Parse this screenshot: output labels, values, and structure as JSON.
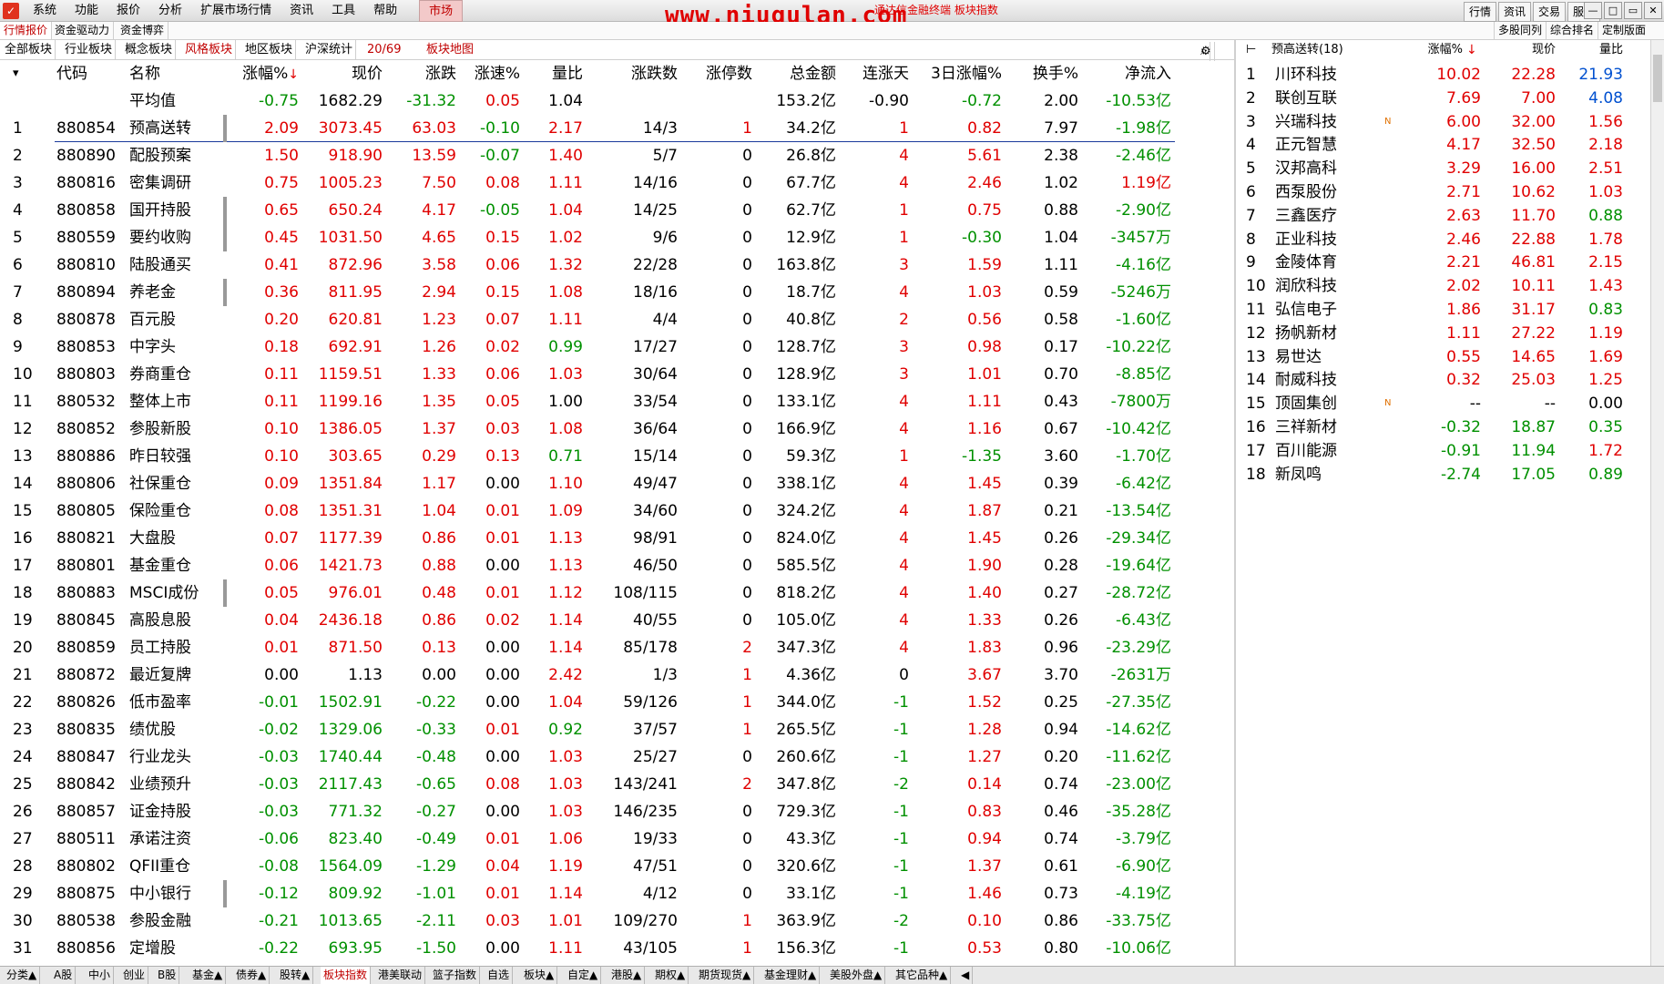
{
  "menu": [
    "系统",
    "功能",
    "报价",
    "分析",
    "扩展市场行情",
    "资讯",
    "工具",
    "帮助",
    "市场"
  ],
  "watermark": "www.niugulan.com",
  "watermark_sub": "通达信金融终端 板块指数",
  "title_right_buttons": [
    "行情",
    "资讯",
    "交易",
    "服务"
  ],
  "window_controls": [
    "—",
    "□",
    "▭",
    "✕"
  ],
  "tabs_top": [
    "行情报价",
    "资金驱动力",
    "资金博弈"
  ],
  "tabs_top_right": [
    "多股同列",
    "综合排名",
    "定制版面"
  ],
  "tabs_second": [
    "全部板块",
    "行业板块",
    "概念板块",
    "风格板块",
    "地区板块",
    "沪深统计"
  ],
  "page_count": "20/69",
  "block_map": "板块地图",
  "table": {
    "headers": {
      "code": "代码",
      "name": "名称",
      "pct": "涨幅%",
      "price": "现价",
      "chg": "涨跌",
      "spd": "涨速%",
      "vol": "量比",
      "ud": "涨跌数",
      "lim": "涨停数",
      "amt": "总金额",
      "days": "连涨天",
      "d3": "3日涨幅%",
      "turn": "换手%",
      "net": "净流入"
    },
    "avg": {
      "name": "平均值",
      "pct": "-0.75",
      "price": "1682.29",
      "chg": "-31.32",
      "spd": "0.05",
      "vol": "1.04",
      "ud": "",
      "lim": "",
      "amt": "153.2亿",
      "days": "-0.90",
      "d3": "-0.72",
      "turn": "2.00",
      "net": "-10.53亿"
    },
    "rows": [
      {
        "idx": "1",
        "code": "880854",
        "name": "预高送转",
        "dot": true,
        "pct": "2.09",
        "price": "3073.45",
        "chg": "63.03",
        "spd": "-0.10",
        "vol": "2.17",
        "ud": "14/3",
        "lim": "1",
        "amt": "34.2亿",
        "days": "1",
        "d3": "0.82",
        "turn": "7.97",
        "net": "-1.98亿"
      },
      {
        "idx": "2",
        "code": "880890",
        "name": "配股预案",
        "dot": false,
        "pct": "1.50",
        "price": "918.90",
        "chg": "13.59",
        "spd": "-0.07",
        "vol": "1.40",
        "ud": "5/7",
        "lim": "0",
        "amt": "26.8亿",
        "days": "4",
        "d3": "5.61",
        "turn": "2.38",
        "net": "-2.46亿"
      },
      {
        "idx": "3",
        "code": "880816",
        "name": "密集调研",
        "dot": false,
        "pct": "0.75",
        "price": "1005.23",
        "chg": "7.50",
        "spd": "0.08",
        "vol": "1.11",
        "ud": "14/16",
        "lim": "0",
        "amt": "67.7亿",
        "days": "4",
        "d3": "2.46",
        "turn": "1.02",
        "net": "1.19亿"
      },
      {
        "idx": "4",
        "code": "880858",
        "name": "国开持股",
        "dot": true,
        "pct": "0.65",
        "price": "650.24",
        "chg": "4.17",
        "spd": "-0.05",
        "vol": "1.04",
        "ud": "14/25",
        "lim": "0",
        "amt": "62.7亿",
        "days": "1",
        "d3": "0.75",
        "turn": "0.88",
        "net": "-2.90亿"
      },
      {
        "idx": "5",
        "code": "880559",
        "name": "要约收购",
        "dot": true,
        "pct": "0.45",
        "price": "1031.50",
        "chg": "4.65",
        "spd": "0.15",
        "vol": "1.02",
        "ud": "9/6",
        "lim": "0",
        "amt": "12.9亿",
        "days": "1",
        "d3": "-0.30",
        "turn": "1.04",
        "net": "-3457万"
      },
      {
        "idx": "6",
        "code": "880810",
        "name": "陆股通买",
        "dot": false,
        "pct": "0.41",
        "price": "872.96",
        "chg": "3.58",
        "spd": "0.06",
        "vol": "1.32",
        "ud": "22/28",
        "lim": "0",
        "amt": "163.8亿",
        "days": "3",
        "d3": "1.59",
        "turn": "1.11",
        "net": "-4.16亿"
      },
      {
        "idx": "7",
        "code": "880894",
        "name": "养老金",
        "dot": true,
        "pct": "0.36",
        "price": "811.95",
        "chg": "2.94",
        "spd": "0.15",
        "vol": "1.08",
        "ud": "18/16",
        "lim": "0",
        "amt": "18.7亿",
        "days": "4",
        "d3": "1.03",
        "turn": "0.59",
        "net": "-5246万"
      },
      {
        "idx": "8",
        "code": "880878",
        "name": "百元股",
        "dot": false,
        "pct": "0.20",
        "price": "620.81",
        "chg": "1.23",
        "spd": "0.07",
        "vol": "1.11",
        "ud": "4/4",
        "lim": "0",
        "amt": "40.8亿",
        "days": "2",
        "d3": "0.56",
        "turn": "0.58",
        "net": "-1.60亿"
      },
      {
        "idx": "9",
        "code": "880853",
        "name": "中字头",
        "dot": false,
        "pct": "0.18",
        "price": "692.91",
        "chg": "1.26",
        "spd": "0.02",
        "vol": "0.99",
        "ud": "17/27",
        "lim": "0",
        "amt": "128.7亿",
        "days": "3",
        "d3": "0.98",
        "turn": "0.17",
        "net": "-10.22亿"
      },
      {
        "idx": "10",
        "code": "880803",
        "name": "券商重仓",
        "dot": false,
        "pct": "0.11",
        "price": "1159.51",
        "chg": "1.33",
        "spd": "0.06",
        "vol": "1.03",
        "ud": "30/64",
        "lim": "0",
        "amt": "128.9亿",
        "days": "3",
        "d3": "1.01",
        "turn": "0.70",
        "net": "-8.85亿"
      },
      {
        "idx": "11",
        "code": "880532",
        "name": "整体上市",
        "dot": false,
        "pct": "0.11",
        "price": "1199.16",
        "chg": "1.35",
        "spd": "0.05",
        "vol": "1.00",
        "ud": "33/54",
        "lim": "0",
        "amt": "133.1亿",
        "days": "4",
        "d3": "1.11",
        "turn": "0.43",
        "net": "-7800万"
      },
      {
        "idx": "12",
        "code": "880852",
        "name": "参股新股",
        "dot": false,
        "pct": "0.10",
        "price": "1386.05",
        "chg": "1.37",
        "spd": "0.03",
        "vol": "1.08",
        "ud": "36/64",
        "lim": "0",
        "amt": "166.9亿",
        "days": "4",
        "d3": "1.16",
        "turn": "0.67",
        "net": "-10.42亿"
      },
      {
        "idx": "13",
        "code": "880886",
        "name": "昨日较强",
        "dot": false,
        "pct": "0.10",
        "price": "303.65",
        "chg": "0.29",
        "spd": "0.13",
        "vol": "0.71",
        "ud": "15/14",
        "lim": "0",
        "amt": "59.3亿",
        "days": "1",
        "d3": "-1.35",
        "turn": "3.60",
        "net": "-1.70亿"
      },
      {
        "idx": "14",
        "code": "880806",
        "name": "社保重仓",
        "dot": false,
        "pct": "0.09",
        "price": "1351.84",
        "chg": "1.17",
        "spd": "0.00",
        "vol": "1.10",
        "ud": "49/47",
        "lim": "0",
        "amt": "338.1亿",
        "days": "4",
        "d3": "1.45",
        "turn": "0.39",
        "net": "-6.42亿"
      },
      {
        "idx": "15",
        "code": "880805",
        "name": "保险重仓",
        "dot": false,
        "pct": "0.08",
        "price": "1351.31",
        "chg": "1.04",
        "spd": "0.01",
        "vol": "1.09",
        "ud": "34/60",
        "lim": "0",
        "amt": "324.2亿",
        "days": "4",
        "d3": "1.87",
        "turn": "0.21",
        "net": "-13.54亿"
      },
      {
        "idx": "16",
        "code": "880821",
        "name": "大盘股",
        "dot": false,
        "pct": "0.07",
        "price": "1177.39",
        "chg": "0.86",
        "spd": "0.01",
        "vol": "1.13",
        "ud": "98/91",
        "lim": "0",
        "amt": "824.0亿",
        "days": "4",
        "d3": "1.45",
        "turn": "0.26",
        "net": "-29.34亿"
      },
      {
        "idx": "17",
        "code": "880801",
        "name": "基金重仓",
        "dot": false,
        "pct": "0.06",
        "price": "1421.73",
        "chg": "0.88",
        "spd": "0.00",
        "vol": "1.13",
        "ud": "46/50",
        "lim": "0",
        "amt": "585.5亿",
        "days": "4",
        "d3": "1.90",
        "turn": "0.28",
        "net": "-19.64亿"
      },
      {
        "idx": "18",
        "code": "880883",
        "name": "MSCI成份",
        "dot": true,
        "pct": "0.05",
        "price": "976.01",
        "chg": "0.48",
        "spd": "0.01",
        "vol": "1.12",
        "ud": "108/115",
        "lim": "0",
        "amt": "818.2亿",
        "days": "4",
        "d3": "1.40",
        "turn": "0.27",
        "net": "-28.72亿"
      },
      {
        "idx": "19",
        "code": "880845",
        "name": "高股息股",
        "dot": false,
        "pct": "0.04",
        "price": "2436.18",
        "chg": "0.86",
        "spd": "0.02",
        "vol": "1.14",
        "ud": "40/55",
        "lim": "0",
        "amt": "105.0亿",
        "days": "4",
        "d3": "1.33",
        "turn": "0.26",
        "net": "-6.43亿"
      },
      {
        "idx": "20",
        "code": "880859",
        "name": "员工持股",
        "dot": false,
        "pct": "0.01",
        "price": "871.50",
        "chg": "0.13",
        "spd": "0.00",
        "vol": "1.14",
        "ud": "85/178",
        "lim": "2",
        "amt": "347.3亿",
        "days": "4",
        "d3": "1.83",
        "turn": "0.96",
        "net": "-23.29亿"
      },
      {
        "idx": "21",
        "code": "880872",
        "name": "最近复牌",
        "dot": false,
        "pct": "0.00",
        "price": "1.13",
        "chg": "0.00",
        "spd": "0.00",
        "vol": "2.42",
        "ud": "1/3",
        "lim": "1",
        "amt": "4.36亿",
        "days": "0",
        "d3": "3.67",
        "turn": "3.70",
        "net": "-2631万"
      },
      {
        "idx": "22",
        "code": "880826",
        "name": "低市盈率",
        "dot": false,
        "pct": "-0.01",
        "price": "1502.91",
        "chg": "-0.22",
        "spd": "0.00",
        "vol": "1.04",
        "ud": "59/126",
        "lim": "1",
        "amt": "344.0亿",
        "days": "-1",
        "d3": "1.52",
        "turn": "0.25",
        "net": "-27.35亿"
      },
      {
        "idx": "23",
        "code": "880835",
        "name": "绩优股",
        "dot": false,
        "pct": "-0.02",
        "price": "1329.06",
        "chg": "-0.33",
        "spd": "0.01",
        "vol": "0.92",
        "ud": "37/57",
        "lim": "1",
        "amt": "265.5亿",
        "days": "-1",
        "d3": "1.28",
        "turn": "0.94",
        "net": "-14.62亿"
      },
      {
        "idx": "24",
        "code": "880847",
        "name": "行业龙头",
        "dot": false,
        "pct": "-0.03",
        "price": "1740.44",
        "chg": "-0.48",
        "spd": "0.00",
        "vol": "1.03",
        "ud": "25/27",
        "lim": "0",
        "amt": "260.6亿",
        "days": "-1",
        "d3": "1.27",
        "turn": "0.20",
        "net": "-11.62亿"
      },
      {
        "idx": "25",
        "code": "880842",
        "name": "业绩预升",
        "dot": false,
        "pct": "-0.03",
        "price": "2117.43",
        "chg": "-0.65",
        "spd": "0.08",
        "vol": "1.03",
        "ud": "143/241",
        "lim": "2",
        "amt": "347.8亿",
        "days": "-2",
        "d3": "0.14",
        "turn": "0.74",
        "net": "-23.00亿"
      },
      {
        "idx": "26",
        "code": "880857",
        "name": "证金持股",
        "dot": false,
        "pct": "-0.03",
        "price": "771.32",
        "chg": "-0.27",
        "spd": "0.00",
        "vol": "1.03",
        "ud": "146/235",
        "lim": "0",
        "amt": "729.3亿",
        "days": "-1",
        "d3": "0.83",
        "turn": "0.46",
        "net": "-35.28亿"
      },
      {
        "idx": "27",
        "code": "880511",
        "name": "承诺注资",
        "dot": false,
        "pct": "-0.06",
        "price": "823.40",
        "chg": "-0.49",
        "spd": "0.01",
        "vol": "1.06",
        "ud": "19/33",
        "lim": "0",
        "amt": "43.3亿",
        "days": "-1",
        "d3": "0.94",
        "turn": "0.74",
        "net": "-3.79亿"
      },
      {
        "idx": "28",
        "code": "880802",
        "name": "QFII重仓",
        "dot": false,
        "pct": "-0.08",
        "price": "1564.09",
        "chg": "-1.29",
        "spd": "0.04",
        "vol": "1.19",
        "ud": "47/51",
        "lim": "0",
        "amt": "320.6亿",
        "days": "-1",
        "d3": "1.37",
        "turn": "0.61",
        "net": "-6.90亿"
      },
      {
        "idx": "29",
        "code": "880875",
        "name": "中小银行",
        "dot": true,
        "pct": "-0.12",
        "price": "809.92",
        "chg": "-1.01",
        "spd": "0.01",
        "vol": "1.14",
        "ud": "4/12",
        "lim": "0",
        "amt": "33.1亿",
        "days": "-1",
        "d3": "1.46",
        "turn": "0.73",
        "net": "-4.19亿"
      },
      {
        "idx": "30",
        "code": "880538",
        "name": "参股金融",
        "dot": false,
        "pct": "-0.21",
        "price": "1013.65",
        "chg": "-2.11",
        "spd": "0.03",
        "vol": "1.01",
        "ud": "109/270",
        "lim": "1",
        "amt": "363.9亿",
        "days": "-2",
        "d3": "0.10",
        "turn": "0.86",
        "net": "-33.75亿"
      },
      {
        "idx": "31",
        "code": "880856",
        "name": "定增股",
        "dot": false,
        "pct": "-0.22",
        "price": "693.95",
        "chg": "-1.50",
        "spd": "0.00",
        "vol": "1.11",
        "ud": "43/105",
        "lim": "1",
        "amt": "156.3亿",
        "days": "-1",
        "d3": "0.53",
        "turn": "0.80",
        "net": "-10.06亿"
      }
    ]
  },
  "right_panel": {
    "title": "预高送转(18)",
    "headers": {
      "pct": "涨幅%",
      "price": "现价",
      "turn": "量比"
    },
    "rows": [
      {
        "idx": "1",
        "name": "川环科技",
        "flag": "",
        "pct": "10.02",
        "price": "22.28",
        "turn": "21.93",
        "turn_color": "b"
      },
      {
        "idx": "2",
        "name": "联创互联",
        "flag": "",
        "pct": "7.69",
        "price": "7.00",
        "turn": "4.08",
        "turn_color": "b"
      },
      {
        "idx": "3",
        "name": "兴瑞科技",
        "flag": "N",
        "pct": "6.00",
        "price": "32.00",
        "turn": "1.56",
        "turn_color": "r"
      },
      {
        "idx": "4",
        "name": "正元智慧",
        "flag": "",
        "pct": "4.17",
        "price": "32.50",
        "turn": "2.18",
        "turn_color": "r"
      },
      {
        "idx": "5",
        "name": "汉邦高科",
        "flag": "",
        "pct": "3.29",
        "price": "16.00",
        "turn": "2.51",
        "turn_color": "r"
      },
      {
        "idx": "6",
        "name": "西泵股份",
        "flag": "",
        "pct": "2.71",
        "price": "10.62",
        "turn": "1.03",
        "turn_color": "r"
      },
      {
        "idx": "7",
        "name": "三鑫医疗",
        "flag": "",
        "pct": "2.63",
        "price": "11.70",
        "turn": "0.88",
        "turn_color": "g"
      },
      {
        "idx": "8",
        "name": "正业科技",
        "flag": "",
        "pct": "2.46",
        "price": "22.88",
        "turn": "1.78",
        "turn_color": "r"
      },
      {
        "idx": "9",
        "name": "金陵体育",
        "flag": "",
        "pct": "2.21",
        "price": "46.81",
        "turn": "2.15",
        "turn_color": "r"
      },
      {
        "idx": "10",
        "name": "润欣科技",
        "flag": "",
        "pct": "2.02",
        "price": "10.11",
        "turn": "1.43",
        "turn_color": "r"
      },
      {
        "idx": "11",
        "name": "弘信电子",
        "flag": "",
        "pct": "1.86",
        "price": "31.17",
        "turn": "0.83",
        "turn_color": "g"
      },
      {
        "idx": "12",
        "name": "扬帆新材",
        "flag": "",
        "pct": "1.11",
        "price": "27.22",
        "turn": "1.19",
        "turn_color": "r"
      },
      {
        "idx": "13",
        "name": "易世达",
        "flag": "",
        "pct": "0.55",
        "price": "14.65",
        "turn": "1.69",
        "turn_color": "r"
      },
      {
        "idx": "14",
        "name": "耐威科技",
        "flag": "",
        "pct": "0.32",
        "price": "25.03",
        "turn": "1.25",
        "turn_color": "r"
      },
      {
        "idx": "15",
        "name": "顶固集创",
        "flag": "N",
        "pct": "--",
        "price": "--",
        "turn": "0.00",
        "turn_color": "k"
      },
      {
        "idx": "16",
        "name": "三祥新材",
        "flag": "",
        "pct": "-0.32",
        "price": "18.87",
        "turn": "0.35",
        "turn_color": "g"
      },
      {
        "idx": "17",
        "name": "百川能源",
        "flag": "",
        "pct": "-0.91",
        "price": "11.94",
        "turn": "1.72",
        "turn_color": "r"
      },
      {
        "idx": "18",
        "name": "新凤鸣",
        "flag": "",
        "pct": "-2.74",
        "price": "17.05",
        "turn": "0.89",
        "turn_color": "g"
      }
    ]
  },
  "bottom_tabs": [
    "分类▲",
    "A股",
    "中小",
    "创业",
    "B股",
    "基金▲",
    "债券▲",
    "股转▲",
    "板块指数",
    "港美联动",
    "篮子指数",
    "自选",
    "板块▲",
    "自定▲",
    "港股▲",
    "期权▲",
    "期货现货▲",
    "基金理财▲",
    "美股外盘▲",
    "其它品种▲",
    "◀"
  ],
  "colors": {
    "up": "#e00000",
    "down": "#009000",
    "accent": "#c00000"
  }
}
